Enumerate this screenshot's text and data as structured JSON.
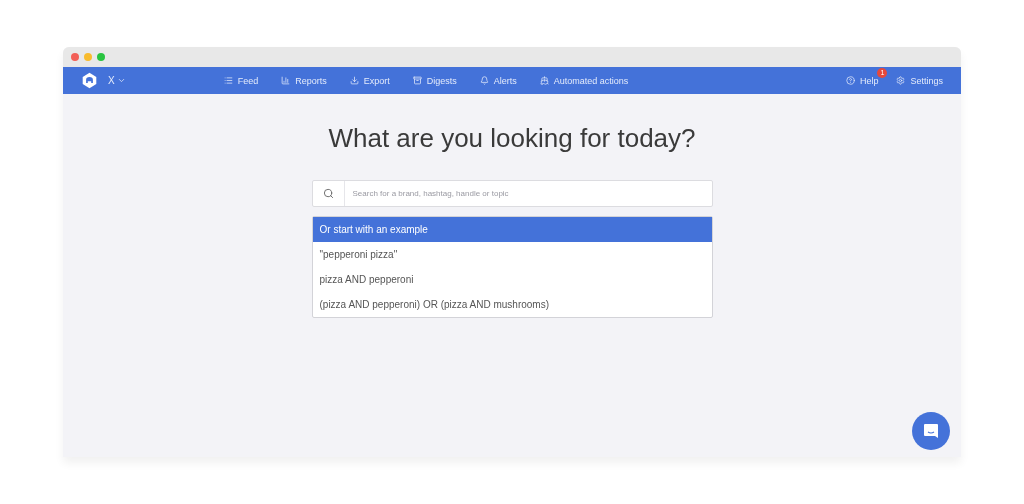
{
  "brand": {
    "account": "X"
  },
  "nav": [
    {
      "label": "Feed",
      "kind": "list"
    },
    {
      "label": "Reports",
      "kind": "chart"
    },
    {
      "label": "Export",
      "kind": "download"
    },
    {
      "label": "Digests",
      "kind": "stack"
    },
    {
      "label": "Alerts",
      "kind": "bell"
    },
    {
      "label": "Automated actions",
      "kind": "auto"
    }
  ],
  "right_nav": [
    {
      "label": "Help",
      "kind": "help",
      "badge": "1"
    },
    {
      "label": "Settings",
      "kind": "gear"
    }
  ],
  "heading": "What are you looking for today?",
  "search": {
    "placeholder": "Search for a brand, hashtag, handle or topic"
  },
  "examples": {
    "header": "Or start with an example",
    "items": [
      "\"pepperoni pizza\"",
      "pizza AND pepperoni",
      "(pizza AND pepperoni) OR (pizza AND mushrooms)"
    ]
  }
}
